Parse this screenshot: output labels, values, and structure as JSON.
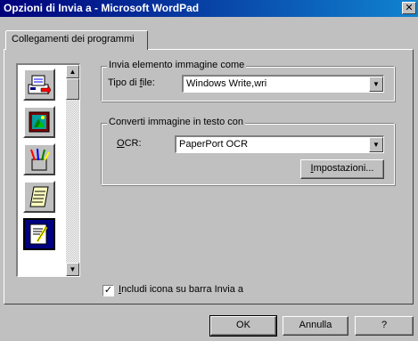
{
  "window": {
    "title": "Opzioni di Invia a - Microsoft WordPad",
    "close_glyph": "✕"
  },
  "tabs": [
    {
      "label": "Collegamenti dei programmi"
    }
  ],
  "icon_list": {
    "items": [
      {
        "icon": "fax-send-icon"
      },
      {
        "icon": "image-editor-icon"
      },
      {
        "icon": "paint-tools-icon"
      },
      {
        "icon": "notepad-icon"
      },
      {
        "icon": "wordpad-document-icon",
        "selected": true
      }
    ],
    "scroll_up": "▲",
    "scroll_down": "▼"
  },
  "image_group": {
    "title": "Invia elemento immagine come",
    "file_type_label_pre": "Tipo di ",
    "file_type_label_u": "f",
    "file_type_label_post": "ile:",
    "file_type_value": "Windows Write,wri",
    "dropdown_arrow": "▼"
  },
  "ocr_group": {
    "title": "Converti immagine in testo con",
    "ocr_label_u": "O",
    "ocr_label_post": "CR:",
    "ocr_value": "PaperPort OCR",
    "settings_pre": "",
    "settings_u": "I",
    "settings_post": "mpostazioni..."
  },
  "checkbox": {
    "checked_glyph": "✓",
    "label_u": "I",
    "label_post": "ncludi icona su barra Invia a"
  },
  "buttons": {
    "ok": "OK",
    "cancel": "Annulla",
    "help": "?"
  }
}
